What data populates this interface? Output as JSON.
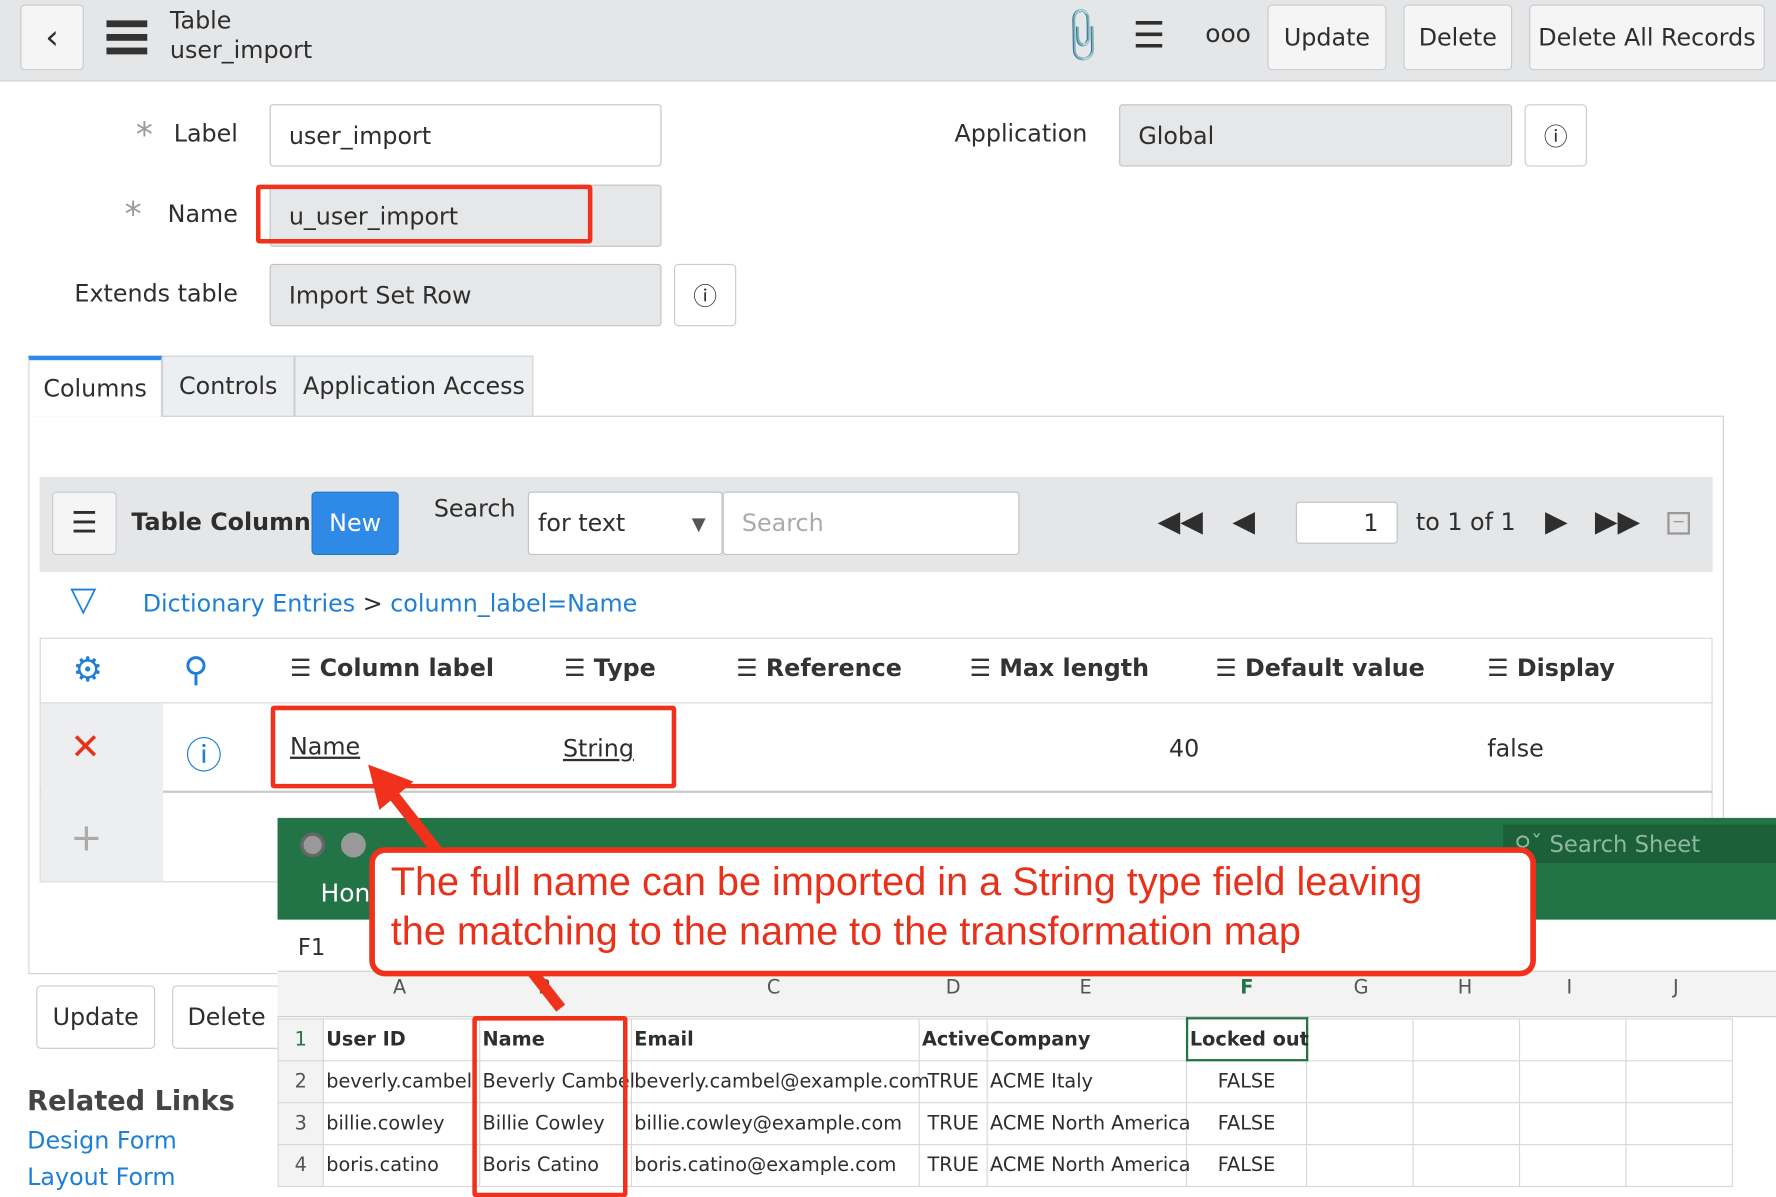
{
  "header": {
    "title": "Table",
    "subtitle": "user_import",
    "update": "Update",
    "delete": "Delete",
    "delete_all": "Delete All Records"
  },
  "form": {
    "label_label": "Label",
    "label_value": "user_import",
    "name_label": "Name",
    "name_value": "u_user_import",
    "extends_label": "Extends table",
    "extends_value": "Import Set Row",
    "application_label": "Application",
    "application_value": "Global"
  },
  "tabs": [
    "Columns",
    "Controls",
    "Application Access"
  ],
  "list": {
    "title": "Table Columns",
    "new": "New",
    "search_label": "Search",
    "search_type": "for text",
    "search_placeholder": "Search",
    "page": "1",
    "page_info": "to 1 of 1",
    "breadcrumb_root": "Dictionary Entries",
    "breadcrumb_sep": ">",
    "breadcrumb_filter": "column_label=Name",
    "columns": [
      "Column label",
      "Type",
      "Reference",
      "Max length",
      "Default value",
      "Display"
    ],
    "row": {
      "column_label": "Name",
      "type": "String",
      "reference": "",
      "max_length": "40",
      "default_value": "",
      "display": "false"
    }
  },
  "bottom": {
    "update": "Update",
    "delete": "Delete",
    "related_title": "Related Links",
    "links": [
      "Design Form",
      "Layout Form"
    ]
  },
  "excel": {
    "search": "Search Sheet",
    "home": "Hon",
    "cell_ref": "F1",
    "col_letters": [
      "A",
      "B",
      "C",
      "D",
      "E",
      "F",
      "G",
      "H",
      "I",
      "J"
    ],
    "rows": [
      [
        "User ID",
        "Name",
        "Email",
        "Active",
        "Company",
        "Locked out"
      ],
      [
        "beverly.cambel",
        "Beverly Cambel",
        "beverly.cambel@example.com",
        "TRUE",
        "ACME Italy",
        "FALSE"
      ],
      [
        "billie.cowley",
        "Billie Cowley",
        "billie.cowley@example.com",
        "TRUE",
        "ACME North America",
        "FALSE"
      ],
      [
        "boris.catino",
        "Boris Catino",
        "boris.catino@example.com",
        "TRUE",
        "ACME North America",
        "FALSE"
      ]
    ]
  },
  "callout": {
    "line1": "The full name can be imported in a String type field leaving",
    "line2": "the matching to the name to the transformation map"
  }
}
